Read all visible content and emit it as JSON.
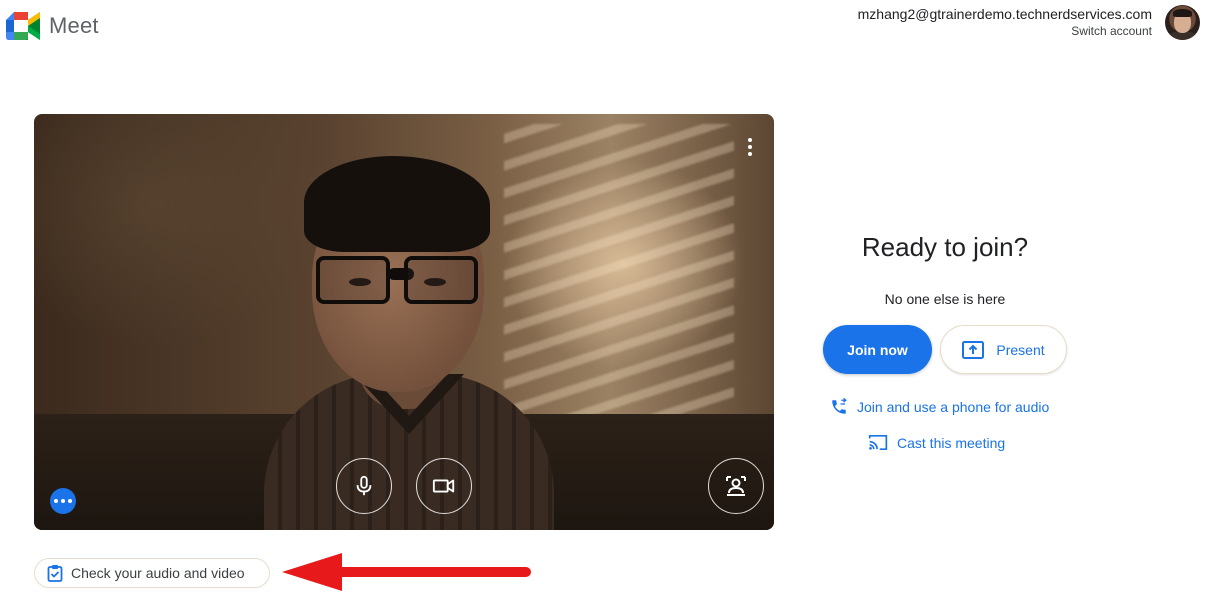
{
  "header": {
    "app_name": "Meet",
    "account_email": "mzhang2@gtrainerdemo.technerdservices.com",
    "switch_account_label": "Switch account"
  },
  "preview": {
    "more_options_icon": "more-vert-icon",
    "mic_icon": "microphone-icon",
    "camera_icon": "videocam-icon",
    "effects_icon": "visual-effects-icon",
    "more_actions_icon": "more-horiz-icon"
  },
  "join_panel": {
    "title": "Ready to join?",
    "status": "No one else is here",
    "join_now_label": "Join now",
    "present_label": "Present",
    "phone_audio_label": "Join and use a phone for audio",
    "cast_label": "Cast this meeting"
  },
  "footer": {
    "check_av_label": "Check your audio and video"
  },
  "colors": {
    "accent": "#1a73e8",
    "annotation_arrow": "#e8191a"
  }
}
